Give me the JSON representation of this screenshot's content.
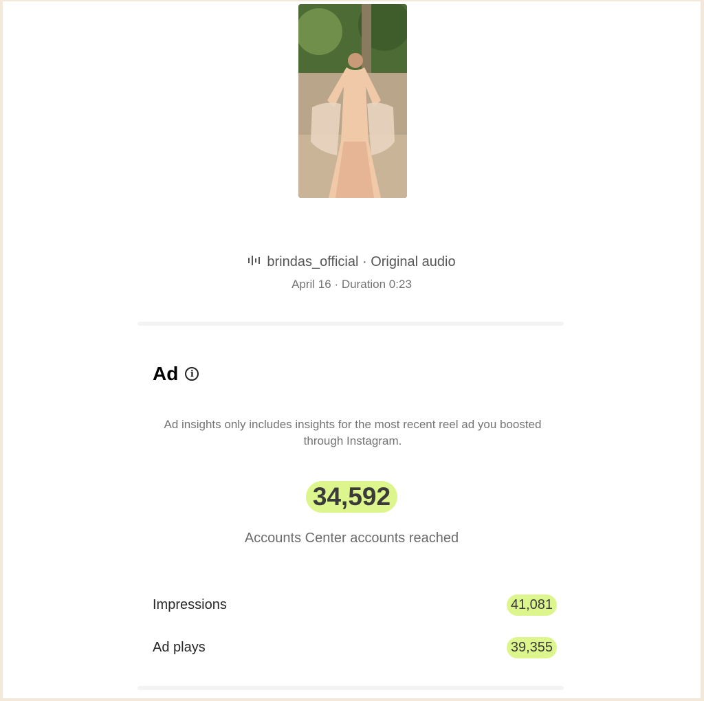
{
  "media": {
    "thumbnail_icon": "reel-thumbnail-image"
  },
  "audio": {
    "icon": "audio-wave-icon",
    "text": "brindas_official · Original audio"
  },
  "meta": {
    "text": "April 16 · Duration 0:23"
  },
  "ad": {
    "title": "Ad",
    "info_icon_glyph": "i",
    "note": "Ad insights only includes insights for the most recent reel ad you boosted through Instagram.",
    "reached_value": "34,592",
    "reached_label": "Accounts Center accounts reached",
    "metrics": [
      {
        "label": "Impressions",
        "value": "41,081"
      },
      {
        "label": "Ad plays",
        "value": "39,355"
      }
    ],
    "highlight_color": "#dcf68d"
  }
}
